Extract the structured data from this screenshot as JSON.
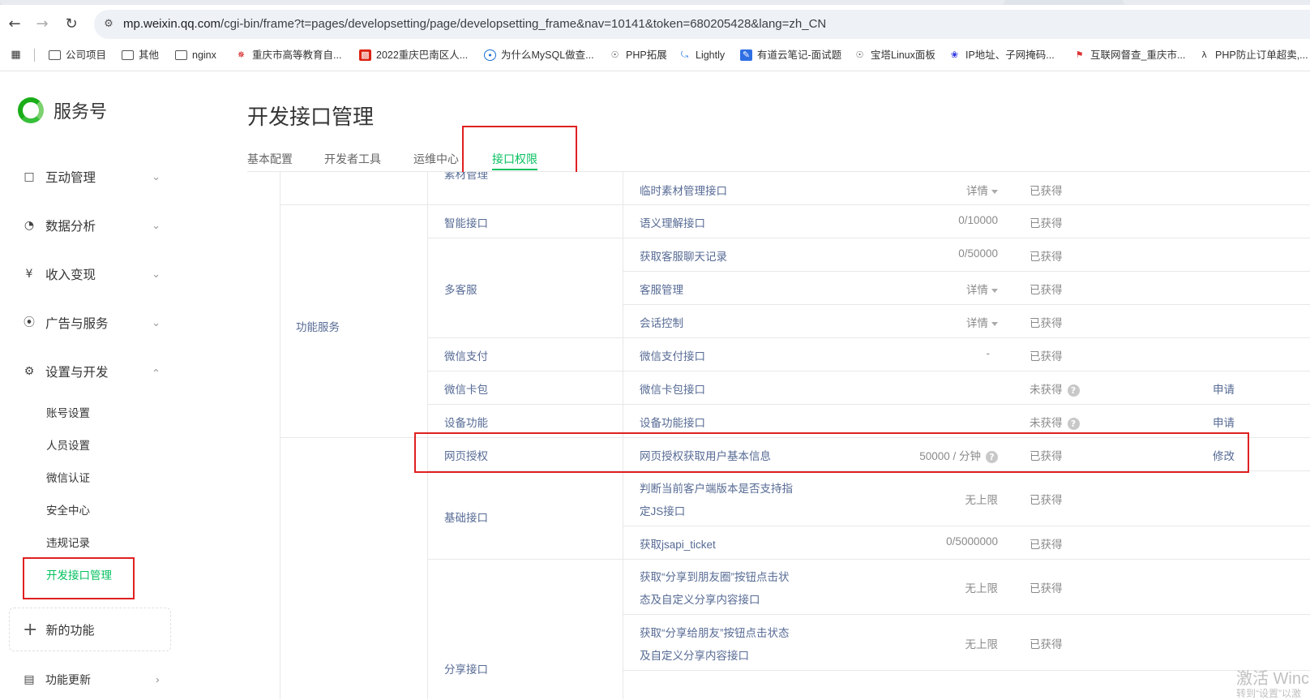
{
  "browser": {
    "url_host": "mp.weixin.qq.com",
    "url_rest": "/cgi-bin/frame?t=pages/developsetting/page/developsetting_frame&nav=10141&token=680205428&lang=zh_CN",
    "bookmarks": [
      {
        "label": "公司项目",
        "icon": "folder-icon"
      },
      {
        "label": "其他",
        "icon": "folder-icon"
      },
      {
        "label": "nginx",
        "icon": "folder-icon"
      },
      {
        "label": "重庆市高等教育自...",
        "icon": "site-icon"
      },
      {
        "label": "2022重庆巴南区人...",
        "icon": "site-icon"
      },
      {
        "label": "为什么MySQL做查...",
        "icon": "site-icon"
      },
      {
        "label": "PHP拓展",
        "icon": "globe-icon"
      },
      {
        "label": "Lightly",
        "icon": "site-icon"
      },
      {
        "label": "有道云笔记-面试题",
        "icon": "site-icon"
      },
      {
        "label": "宝塔Linux面板",
        "icon": "globe-icon"
      },
      {
        "label": "IP地址、子网掩码...",
        "icon": "site-icon"
      },
      {
        "label": "互联网督查_重庆市...",
        "icon": "site-icon"
      },
      {
        "label": "PHP防止订单超卖,...",
        "icon": "site-icon"
      }
    ]
  },
  "sidebar": {
    "logo_text": "服务号",
    "menu": [
      {
        "label": "互动管理",
        "icon": "chat-icon",
        "expanded": false
      },
      {
        "label": "数据分析",
        "icon": "pie-chart-icon",
        "expanded": false
      },
      {
        "label": "收入变现",
        "icon": "yen-icon",
        "expanded": false
      },
      {
        "label": "广告与服务",
        "icon": "compass-icon",
        "expanded": false
      },
      {
        "label": "设置与开发",
        "icon": "gear-icon",
        "expanded": true
      }
    ],
    "sub_items": [
      "账号设置",
      "人员设置",
      "微信认证",
      "安全中心",
      "违规记录",
      "开发接口管理"
    ],
    "active_sub": "开发接口管理",
    "new_feature": "新的功能",
    "bottom_item": "功能更新"
  },
  "main": {
    "title": "开发接口管理",
    "tabs": [
      "基本配置",
      "开发者工具",
      "运维中心",
      "接口权限"
    ],
    "active_tab": "接口权限"
  },
  "table": {
    "top_partial_subcategory": "素材管理",
    "category_1": "功能服务",
    "subcategories": [
      "智能接口",
      "多客服",
      "微信支付",
      "微信卡包",
      "设备功能",
      "网页授权",
      "基础接口",
      "分享接口"
    ],
    "rows": [
      {
        "api": "临时素材管理接口",
        "quota": "详情",
        "status": "已获得",
        "op": ""
      },
      {
        "api": "语义理解接口",
        "quota": "0/10000",
        "status": "已获得",
        "op": ""
      },
      {
        "api": "获取客服聊天记录",
        "quota": "0/50000",
        "status": "已获得",
        "op": ""
      },
      {
        "api": "客服管理",
        "quota": "详情",
        "status": "已获得",
        "op": ""
      },
      {
        "api": "会话控制",
        "quota": "详情",
        "status": "已获得",
        "op": ""
      },
      {
        "api": "微信支付接口",
        "quota": "-",
        "status": "已获得",
        "op": ""
      },
      {
        "api": "微信卡包接口",
        "quota": "",
        "status": "未获得",
        "op": "申请"
      },
      {
        "api": "设备功能接口",
        "quota": "",
        "status": "未获得",
        "op": "申请"
      },
      {
        "api": "网页授权获取用户基本信息",
        "quota": "50000 / 分钟",
        "status": "已获得",
        "op": "修改"
      },
      {
        "api_line1": "判断当前客户端版本是否支持指",
        "api_line2": "定JS接口",
        "quota": "无上限",
        "status": "已获得",
        "op": ""
      },
      {
        "api": "获取jsapi_ticket",
        "quota": "0/5000000",
        "status": "已获得",
        "op": ""
      },
      {
        "api_line1": "获取“分享到朋友圈”按钮点击状",
        "api_line2": "态及自定义分享内容接口",
        "quota": "无上限",
        "status": "已获得",
        "op": ""
      },
      {
        "api_line1": "获取“分享给朋友”按钮点击状态",
        "api_line2": "及自定义分享内容接口",
        "quota": "无上限",
        "status": "已获得",
        "op": ""
      }
    ]
  },
  "watermark": {
    "line1": "激活 Winc",
    "line2": "转到“设置”以激"
  }
}
